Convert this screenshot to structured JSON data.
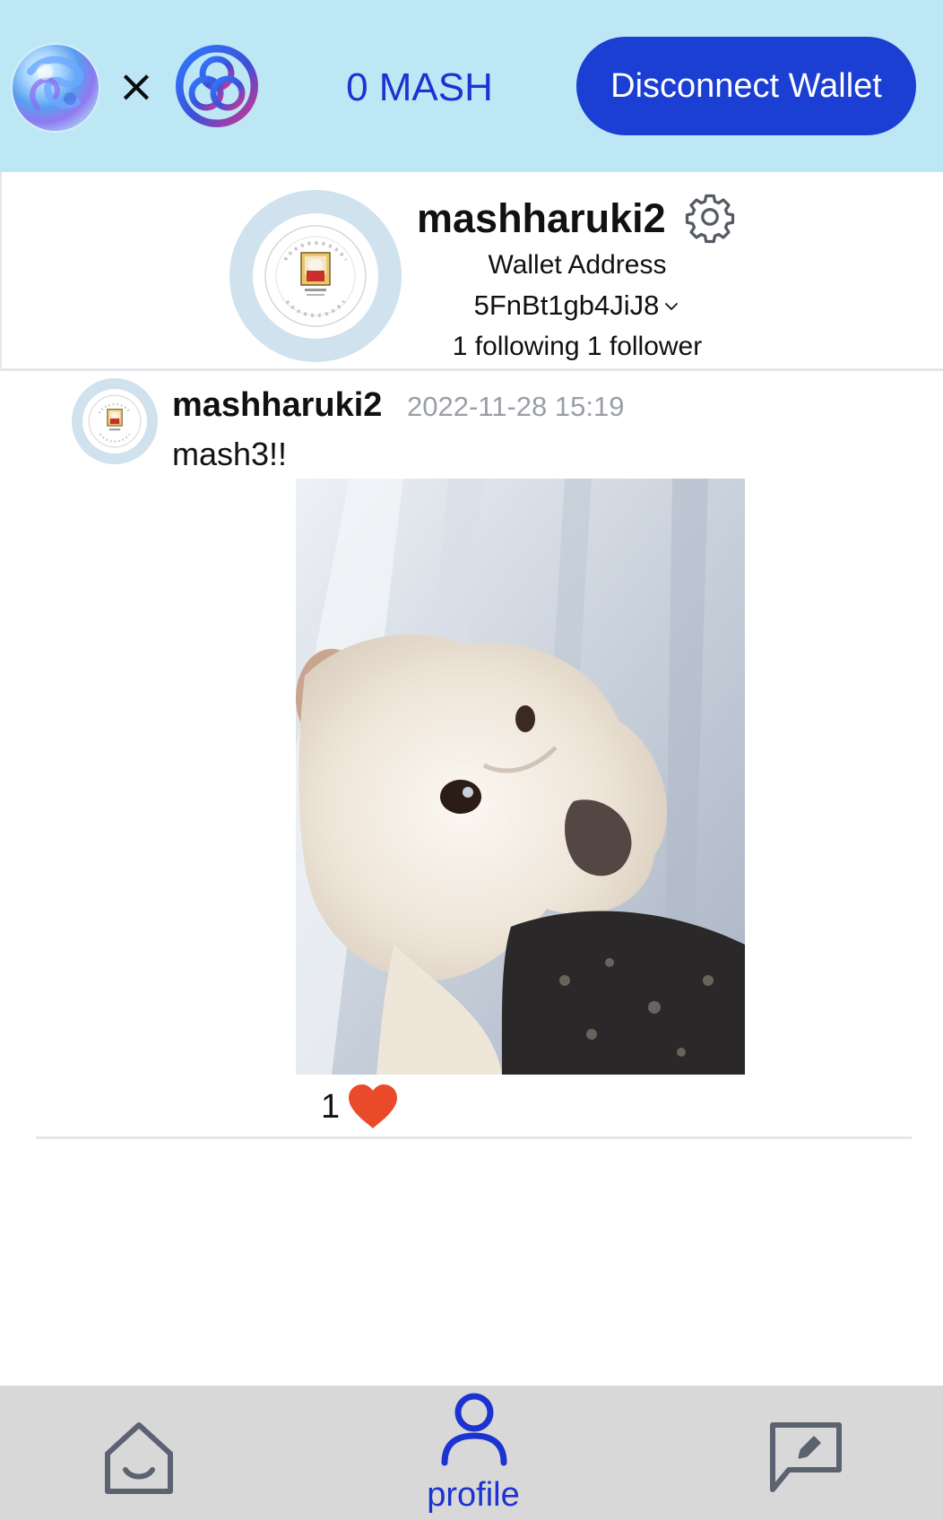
{
  "header": {
    "left_logo_icon": "mash-swirl-logo-icon",
    "separator": "×",
    "right_logo_icon": "trefoil-knot-logo-icon",
    "balance": "0 MASH",
    "disconnect_label": "Disconnect Wallet",
    "colors": {
      "background": "#bde7f4",
      "accent": "#1b3ed3",
      "balance_text": "#1b33d1"
    }
  },
  "profile": {
    "avatar_icon": "mash-project-badge-icon",
    "username": "mashharuki2",
    "settings_icon": "gear-icon",
    "wallet_label": "Wallet Address",
    "wallet_address": "5FnBt1gb4JiJ8",
    "address_dropdown_icon": "chevron-down-icon",
    "follow_stats": "1 following 1 follower"
  },
  "posts": [
    {
      "avatar_icon": "mash-project-badge-icon",
      "username": "mashharuki2",
      "timestamp": "2022-11-28 15:19",
      "text": "mash3!!",
      "image_icon": "white-dog-photo",
      "like_count": "1",
      "like_icon": "heart-icon",
      "colors": {
        "heart": "#ea4a2a",
        "timestamp": "#9a9ea6"
      }
    }
  ],
  "bottom_nav": {
    "home_icon": "home-icon",
    "profile_icon": "user-icon",
    "profile_label": "profile",
    "post_icon": "edit-message-icon",
    "colors": {
      "background": "#d8d8d8",
      "active": "#1b33d1",
      "inactive": "#5b6270"
    }
  }
}
